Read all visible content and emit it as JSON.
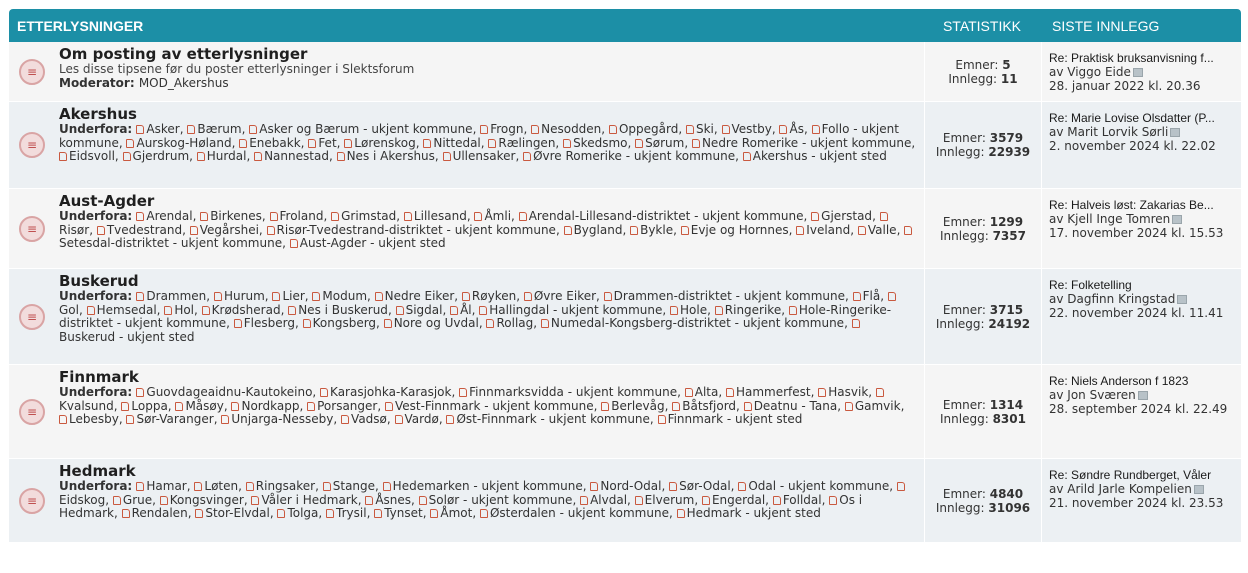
{
  "header": {
    "forum": "ETTERLYSNINGER",
    "stats": "STATISTIKK",
    "last": "SISTE INNLEGG"
  },
  "labels": {
    "topics": "Emner:",
    "posts": "Innlegg:",
    "subforums": "Underfora:",
    "moderator": "Moderator:",
    "by": "av"
  },
  "forums": [
    {
      "title": "Om posting av etterlysninger",
      "desc": "Les disse tipsene før du poster etterlysninger i Slektsforum",
      "moderator": "MOD_Akershus",
      "topics": "5",
      "posts": "11",
      "last_title": "Re: Praktisk bruksanvisning f...",
      "last_author": "Viggo Eide",
      "last_date": "28. januar 2022 kl. 20.36"
    },
    {
      "title": "Akershus",
      "subforums": [
        "Asker",
        "Bærum",
        "Asker og Bærum - ukjent kommune",
        "Frogn",
        "Nesodden",
        "Oppegård",
        "Ski",
        "Vestby",
        "Ås",
        "Follo - ukjent kommune",
        "Aurskog-Høland",
        "Enebakk",
        "Fet",
        "Lørenskog",
        "Nittedal",
        "Rælingen",
        "Skedsmo",
        "Sørum",
        "Nedre Romerike - ukjent kommune",
        "Eidsvoll",
        "Gjerdrum",
        "Hurdal",
        "Nannestad",
        "Nes i Akershus",
        "Ullensaker",
        "Øvre Romerike - ukjent kommune",
        "Akershus - ukjent sted"
      ],
      "topics": "3579",
      "posts": "22939",
      "last_title": "Re: Marie Lovise Olsdatter (P...",
      "last_author": "Marit Lorvik Sørli",
      "last_date": "2. november 2024 kl. 22.02"
    },
    {
      "title": "Aust-Agder",
      "subforums": [
        "Arendal",
        "Birkenes",
        "Froland",
        "Grimstad",
        "Lillesand",
        "Åmli",
        "Arendal-Lillesand-distriktet - ukjent kommune",
        "Gjerstad",
        "Risør",
        "Tvedestrand",
        "Vegårshei",
        "Risør-Tvedestrand-distriktet - ukjent kommune",
        "Bygland",
        "Bykle",
        "Evje og Hornnes",
        "Iveland",
        "Valle",
        "Setesdal-distriktet - ukjent kommune",
        "Aust-Agder - ukjent sted"
      ],
      "topics": "1299",
      "posts": "7357",
      "last_title": "Re: Halveis løst: Zakarias Be...",
      "last_author": "Kjell Inge Tomren",
      "last_date": "17. november 2024 kl. 15.53"
    },
    {
      "title": "Buskerud",
      "subforums": [
        "Drammen",
        "Hurum",
        "Lier",
        "Modum",
        "Nedre Eiker",
        "Røyken",
        "Øvre Eiker",
        "Drammen-distriktet - ukjent kommune",
        "Flå",
        "Gol",
        "Hemsedal",
        "Hol",
        "Krødsherad",
        "Nes i Buskerud",
        "Sigdal",
        "Ål",
        "Hallingdal - ukjent kommune",
        "Hole",
        "Ringerike",
        "Hole-Ringerike-distriktet - ukjent kommune",
        "Flesberg",
        "Kongsberg",
        "Nore og Uvdal",
        "Rollag",
        "Numedal-Kongsberg-distriktet - ukjent kommune",
        "Buskerud - ukjent sted"
      ],
      "topics": "3715",
      "posts": "24192",
      "last_title": "Re: Folketelling",
      "last_author": "Dagfinn Kringstad",
      "last_date": "22. november 2024 kl. 11.41"
    },
    {
      "title": "Finnmark",
      "subforums": [
        "Guovdageaidnu-Kautokeino",
        "Karasjohka-Karasjok",
        "Finnmarksvidda - ukjent kommune",
        "Alta",
        "Hammerfest",
        "Hasvik",
        "Kvalsund",
        "Loppa",
        "Måsøy",
        "Nordkapp",
        "Porsanger",
        "Vest-Finnmark - ukjent kommune",
        "Berlevåg",
        "Båtsfjord",
        "Deatnu - Tana",
        "Gamvik",
        "Lebesby",
        "Sør-Varanger",
        "Unjarga-Nesseby",
        "Vadsø",
        "Vardø",
        "Øst-Finnmark - ukjent kommune",
        "Finnmark - ukjent sted"
      ],
      "topics": "1314",
      "posts": "8301",
      "last_title": "Re: Niels Anderson f 1823",
      "last_author": "Jon Sværen",
      "last_date": "28. september 2024 kl. 22.49"
    },
    {
      "title": "Hedmark",
      "subforums": [
        "Hamar",
        "Løten",
        "Ringsaker",
        "Stange",
        "Hedemarken - ukjent kommune",
        "Nord-Odal",
        "Sør-Odal",
        "Odal - ukjent kommune",
        "Eidskog",
        "Grue",
        "Kongsvinger",
        "Våler i Hedmark",
        "Åsnes",
        "Solør - ukjent kommune",
        "Alvdal",
        "Elverum",
        "Engerdal",
        "Folldal",
        "Os i Hedmark",
        "Rendalen",
        "Stor-Elvdal",
        "Tolga",
        "Trysil",
        "Tynset",
        "Åmot",
        "Østerdalen - ukjent kommune",
        "Hedmark - ukjent sted"
      ],
      "topics": "4840",
      "posts": "31096",
      "last_title": "Re: Søndre Rundberget, Våler",
      "last_author": "Arild Jarle Kompelien",
      "last_date": "21. november 2024 kl. 23.53"
    }
  ]
}
